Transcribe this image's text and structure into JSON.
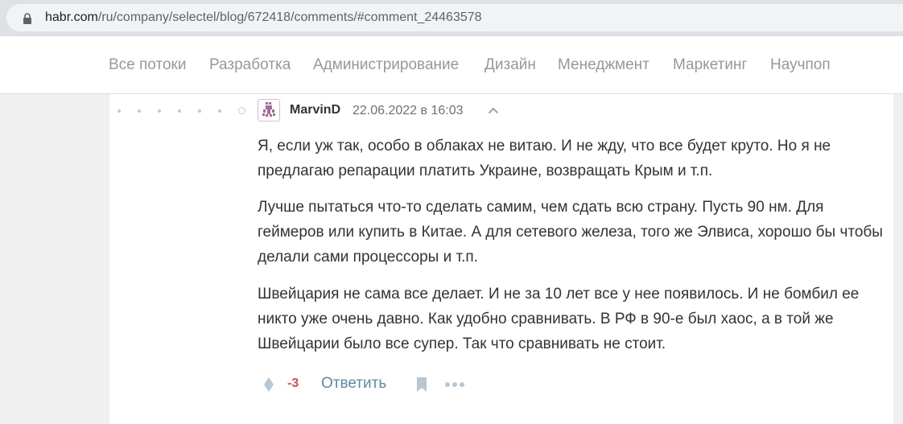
{
  "browser": {
    "url_host": "habr.com",
    "url_path": "/ru/company/selectel/blog/672418/comments/#comment_24463578"
  },
  "nav": {
    "items": [
      "Все потоки",
      "Разработка",
      "Администрирование",
      "Дизайн",
      "Менеджмент",
      "Маркетинг",
      "Научпоп"
    ]
  },
  "comment": {
    "author": "MarvinD",
    "datetime": "22.06.2022 в 16:03",
    "paragraphs": [
      "Я, если уж так, особо в облаках не витаю. И не жду, что все будет круто. Но я не предлагаю репарации платить Украине, возвращать Крым и т.п.",
      "Лучше пытаться что-то сделать самим, чем сдать всю страну. Пусть 90 нм. Для геймеров или купить в Китае. А для сетевого железа, того же Элвиса, хорошо бы чтобы делали сами процессоры и т.п.",
      "Швейцария не сама все делает. И не за 10 лет все у нее появилось. И не бомбил ее никто уже очень давно. Как удобно сравнивать. В РФ в 90-е был хаос, а в той же Швейцарии было все супер. Так что сравнивать не стоит."
    ],
    "score": "-3",
    "reply_label": "Ответить",
    "icons": [
      "vote-icon",
      "bookmark-icon",
      "more-icon",
      "collapse-arrow-icon",
      "user-avatar"
    ]
  },
  "colors": {
    "score_negative": "#d04e4e",
    "link": "#5e8aa4",
    "nav_text": "#909aa0"
  }
}
